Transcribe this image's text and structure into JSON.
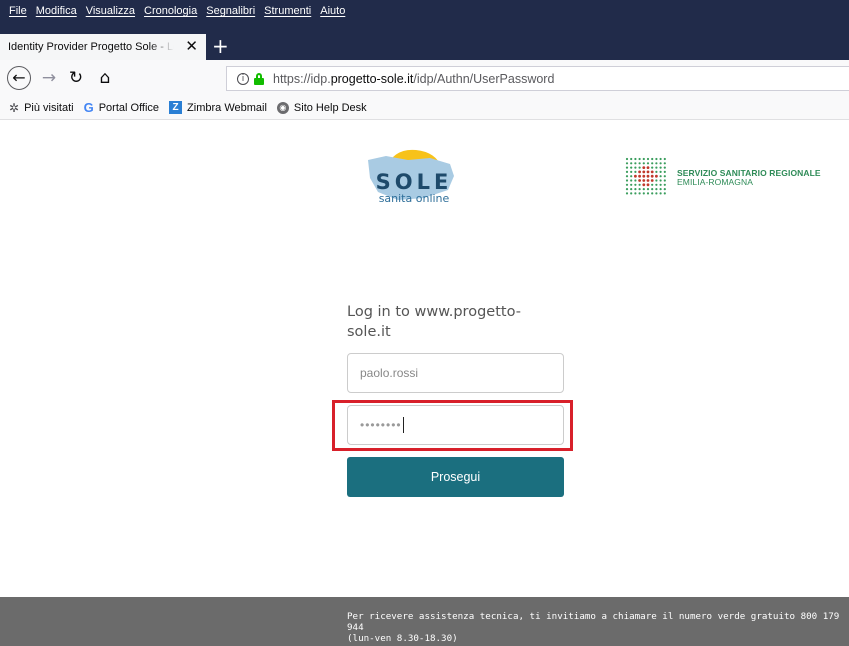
{
  "browser": {
    "menu": [
      "File",
      "Modifica",
      "Visualizza",
      "Cronologia",
      "Segnalibri",
      "Strumenti",
      "Aiuto"
    ],
    "tab_title": "Identity Provider Progetto Sole - Log",
    "url_prefix": "https://idp.",
    "url_host": "progetto-sole.it",
    "url_path": "/idp/Authn/UserPassword",
    "bookmarks": [
      {
        "label": "Più visitati",
        "icon": "gear-icon"
      },
      {
        "label": "Portal Office",
        "icon": "google-icon"
      },
      {
        "label": "Zimbra Webmail",
        "icon": "zimbra-icon"
      },
      {
        "label": "Sito Help Desk",
        "icon": "globe-icon"
      }
    ]
  },
  "logos": {
    "sole_title": "SOLE",
    "sole_subtitle": "sanita online",
    "ssr_line1": "SERVIZIO SANITARIO REGIONALE",
    "ssr_line2": "EMILIA-ROMAGNA"
  },
  "login": {
    "heading": "Log in to www.progetto-sole.it",
    "username_value": "paolo.rossi",
    "password_value": "••••••••",
    "submit_label": "Prosegui"
  },
  "footer": {
    "line1": "Per ricevere assistenza tecnica, ti invitiamo a chiamare il numero verde gratuito 800 179 944",
    "line2": "(lun-ven 8.30-18.30)"
  },
  "colors": {
    "chrome_dark": "#212b4a",
    "button": "#1b6f7f",
    "highlight": "#d8202a",
    "footer": "#6b6b6b",
    "ssr_green": "#2e8b57"
  }
}
